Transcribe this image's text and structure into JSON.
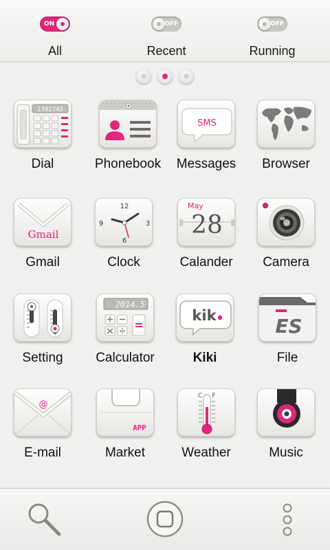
{
  "tabs": [
    {
      "label": "All",
      "toggle_text": "ON",
      "state": "on"
    },
    {
      "label": "Recent",
      "toggle_text": "OFF",
      "state": "off"
    },
    {
      "label": "Running",
      "toggle_text": "OFF",
      "state": "off"
    }
  ],
  "pager": {
    "pages": 3,
    "active_index": 1
  },
  "apps": [
    {
      "label": "Dial",
      "icon": "phone-icon",
      "display_text": "1392742"
    },
    {
      "label": "Phonebook",
      "icon": "contact-card-icon"
    },
    {
      "label": "Messages",
      "icon": "sms-bubble-icon",
      "badge_text": "SMS"
    },
    {
      "label": "Browser",
      "icon": "world-map-icon"
    },
    {
      "label": "Gmail",
      "icon": "envelope-icon",
      "badge_text": "Gmail"
    },
    {
      "label": "Clock",
      "icon": "clock-icon",
      "dial_numbers": [
        "12",
        "3",
        "6",
        "9"
      ]
    },
    {
      "label": "Calander",
      "icon": "calendar-icon",
      "month": "May",
      "day": "28"
    },
    {
      "label": "Camera",
      "icon": "camera-lens-icon"
    },
    {
      "label": "Setting",
      "icon": "sliders-icon"
    },
    {
      "label": "Calculator",
      "icon": "calculator-icon",
      "display_text": "2014.5"
    },
    {
      "label": "Kiki",
      "icon": "kik-bubble-icon",
      "badge_text": "kik"
    },
    {
      "label": "File",
      "icon": "es-folder-icon",
      "badge_text": "ES"
    },
    {
      "label": "E-mail",
      "icon": "email-envelope-icon",
      "badge_text": "@"
    },
    {
      "label": "Market",
      "icon": "market-bag-icon",
      "badge_text": "APP"
    },
    {
      "label": "Weather",
      "icon": "thermometer-icon",
      "scale_c": "C",
      "scale_f": "F"
    },
    {
      "label": "Music",
      "icon": "music-speaker-icon"
    }
  ],
  "dock": [
    {
      "icon": "search-icon"
    },
    {
      "icon": "home-icon"
    },
    {
      "icon": "more-menu-icon"
    }
  ],
  "colors": {
    "accent": "#e0287a",
    "background": "#f1f0ef",
    "icon_face": "#f8f7f6"
  }
}
